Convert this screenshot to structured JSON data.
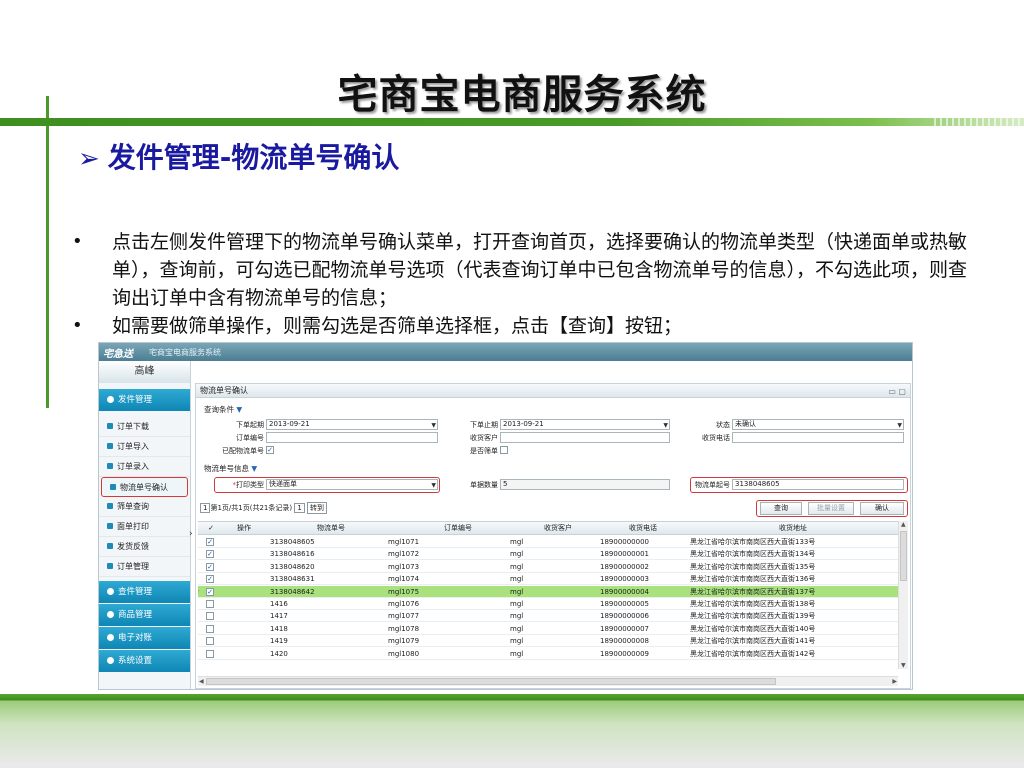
{
  "slide": {
    "title": "宅商宝电商服务系统",
    "subtitle_arrow": "➢",
    "subtitle": "发件管理-物流单号确认",
    "bullets": [
      "点击左侧发件管理下的物流单号确认菜单，打开查询首页，选择要确认的物流单类型（快递面单或热敏单），查询前，可勾选已配物流单号选项（代表查询订单中已包含物流单号的信息），不勾选此项，则查询出订单中含有物流单号的信息；",
      "如需要做筛单操作，则需勾选是否筛单选择框，点击【查询】按钮；"
    ]
  },
  "app": {
    "logo": "宅急送",
    "name": "宅商宝电商服务系统",
    "user": "高峰",
    "collapse_glyph": "›",
    "sidebar": {
      "sections": [
        {
          "label": "发件管理",
          "expanded": true
        },
        {
          "label": "查件管理"
        },
        {
          "label": "商品管理"
        },
        {
          "label": "电子对账"
        },
        {
          "label": "系统设置"
        }
      ],
      "items": [
        "订单下载",
        "订单导入",
        "订单录入",
        "物流单号确认",
        "筛单查询",
        "面单打印",
        "发货反馈",
        "订单管理"
      ]
    },
    "panel": {
      "title": "物流单号确认",
      "tools": "▭ ▢",
      "query_group": "查询条件",
      "group_caret": "▼",
      "select_arrow": "▼",
      "fields": {
        "order_start_label": "下单起期",
        "order_start_value": "2013-09-21",
        "order_end_label": "下单止期",
        "order_end_value": "2013-09-21",
        "status_label": "状态",
        "status_value": "未确认",
        "order_no_label": "订单编号",
        "customer_label": "收货客户",
        "phone_label": "收货电话",
        "assigned_label": "已配物流单号",
        "screen_label": "是否筛单",
        "logistics_group": "物流单号信息",
        "print_type_label": "打印类型",
        "print_type_value": "快递面单",
        "doc_count_label": "单据数量",
        "doc_count_value": "5",
        "start_no_label": "物流单起号",
        "start_no_value": "3138048605"
      },
      "buttons": {
        "query": "查询",
        "batch": "批量设置",
        "confirm": "确认"
      },
      "pager": {
        "page_input": "1",
        "info": "第1页/共1页(共21条记录)",
        "goto_input": "1",
        "goto_btn": "转到"
      },
      "grid": {
        "columns": [
          "操作",
          "物流单号",
          "订单编号",
          "收货客户",
          "收货电话",
          "收货地址"
        ],
        "rows": [
          {
            "checked": true,
            "logistics_no": "3138048605",
            "order_no": "mgl1071",
            "customer": "mgl",
            "phone": "18900000000",
            "address": "黑龙江省哈尔滨市南岗区西大直街133号"
          },
          {
            "checked": true,
            "logistics_no": "3138048616",
            "order_no": "mgl1072",
            "customer": "mgl",
            "phone": "18900000001",
            "address": "黑龙江省哈尔滨市南岗区西大直街134号"
          },
          {
            "checked": true,
            "logistics_no": "3138048620",
            "order_no": "mgl1073",
            "customer": "mgl",
            "phone": "18900000002",
            "address": "黑龙江省哈尔滨市南岗区西大直街135号"
          },
          {
            "checked": true,
            "logistics_no": "3138048631",
            "order_no": "mgl1074",
            "customer": "mgl",
            "phone": "18900000003",
            "address": "黑龙江省哈尔滨市南岗区西大直街136号"
          },
          {
            "checked": true,
            "logistics_no": "3138048642",
            "order_no": "mgl1075",
            "customer": "mgl",
            "phone": "18900000004",
            "address": "黑龙江省哈尔滨市南岗区西大直街137号",
            "selected": true
          },
          {
            "checked": false,
            "logistics_no": "1416",
            "order_no": "mgl1076",
            "customer": "mgl",
            "phone": "18900000005",
            "address": "黑龙江省哈尔滨市南岗区西大直街138号"
          },
          {
            "checked": false,
            "logistics_no": "1417",
            "order_no": "mgl1077",
            "customer": "mgl",
            "phone": "18900000006",
            "address": "黑龙江省哈尔滨市南岗区西大直街139号"
          },
          {
            "checked": false,
            "logistics_no": "1418",
            "order_no": "mgl1078",
            "customer": "mgl",
            "phone": "18900000007",
            "address": "黑龙江省哈尔滨市南岗区西大直街140号"
          },
          {
            "checked": false,
            "logistics_no": "1419",
            "order_no": "mgl1079",
            "customer": "mgl",
            "phone": "18900000008",
            "address": "黑龙江省哈尔滨市南岗区西大直街141号"
          },
          {
            "checked": false,
            "logistics_no": "1420",
            "order_no": "mgl1080",
            "customer": "mgl",
            "phone": "18900000009",
            "address": "黑龙江省哈尔滨市南岗区西大直街142号"
          }
        ]
      }
    }
  },
  "colors": {
    "accent_green": "#4a9a28",
    "subtitle_blue": "#1a1aa0",
    "menu_blue": "#1893c4",
    "highlight_red": "#d23a3a",
    "selected_row": "#a9e27c"
  }
}
